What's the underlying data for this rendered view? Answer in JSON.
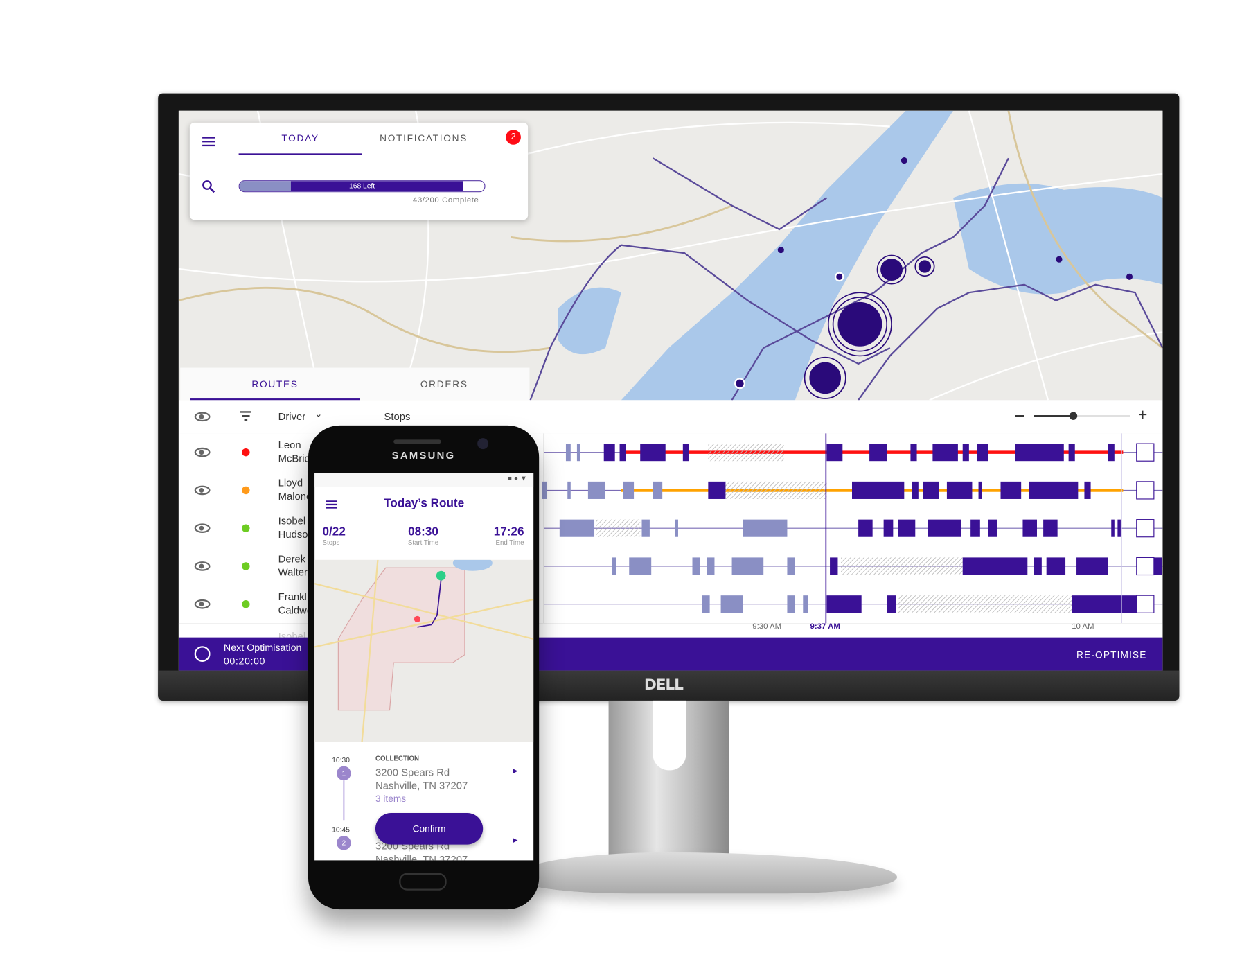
{
  "top_card": {
    "tabs": [
      {
        "label": "TODAY",
        "active": true
      },
      {
        "label": "NOTIFICATIONS",
        "active": false
      }
    ],
    "notification_badge": "2",
    "progress": {
      "label": "168 Left",
      "complete_text": "43/200 Complete",
      "completed": 43,
      "total": 200,
      "fill_fraction": 0.91
    },
    "icons": {
      "menu": "menu-icon",
      "search": "search-icon"
    }
  },
  "panel": {
    "tabs": [
      {
        "label": "ROUTES",
        "active": true
      },
      {
        "label": "ORDERS",
        "active": false
      }
    ],
    "header": {
      "driver_label": "Driver",
      "stops_label": "Stops",
      "zoom_level": 0.7
    },
    "drivers": [
      {
        "first": "Leon",
        "last": "McBride",
        "status_color": "#ff1111"
      },
      {
        "first": "Lloyd",
        "last": "Malone",
        "status_color": "#ff9a1a"
      },
      {
        "first": "Isobel",
        "last": "Hudson",
        "status_color": "#6dcc22"
      },
      {
        "first": "Derek",
        "last": "Walters",
        "status_color": "#6dcc22"
      },
      {
        "first": "Frankl",
        "last": "Caldwell",
        "status_color": "#6dcc22"
      }
    ],
    "partial_row": "Isobel",
    "timeline": {
      "ticks": [
        "9:30 AM",
        "9:37 AM",
        "10 AM"
      ],
      "current_time": "9:37 AM"
    }
  },
  "bottom_bar": {
    "next_label": "Next Optimisation",
    "countdown": "00:20:00",
    "reoptimise": "RE-OPTIMISE"
  },
  "colors": {
    "brand": "#3a1196",
    "light_brand": "#8a8fc4",
    "red": "#ff1111",
    "orange": "#ffa200"
  },
  "monitor_brand": "DELL",
  "phone": {
    "brand": "SAMSUNG",
    "title": "Today’s Route",
    "stats": [
      {
        "value": "0/22",
        "label": "Stops"
      },
      {
        "value": "08:30",
        "label": "Start Time"
      },
      {
        "value": "17:26",
        "label": "End Time"
      }
    ],
    "stops": [
      {
        "time": "10:30",
        "num": "1",
        "type": "COLLECTION",
        "line1": "3200 Spears Rd",
        "line2": "Nashville, TN 37207",
        "items": "3 items"
      },
      {
        "time": "10:45",
        "num": "2",
        "line1": "3200 Spears Rd",
        "line2": "Nashville, TN 37207"
      }
    ],
    "confirm": "Confirm"
  }
}
